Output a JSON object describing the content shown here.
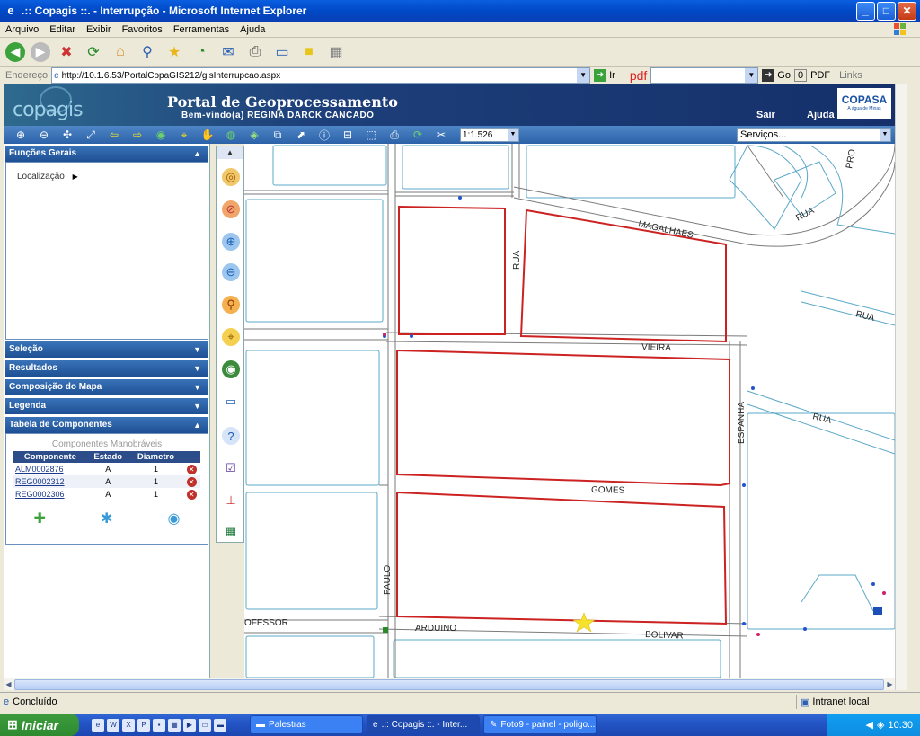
{
  "window": {
    "title": ".:: Copagis ::. - Interrupção - Microsoft Internet Explorer",
    "min": "_",
    "max": "□",
    "close": "✕"
  },
  "menu": [
    "Arquivo",
    "Editar",
    "Exibir",
    "Favoritos",
    "Ferramentas",
    "Ajuda"
  ],
  "address": {
    "label": "Endereço",
    "url": "http://10.1.6.53/PortalCopaGIS212/gisInterrupcao.aspx",
    "go_label": "Ir",
    "pdf_label": "pdf",
    "go2_label": "Go",
    "count": "0",
    "pdf2_label": "PDF",
    "links_label": "Links"
  },
  "portal": {
    "logo": "copagis",
    "title": "Portal de Geoprocessamento",
    "welcome": "Bem-vindo(a) REGINA DARCK CANCADO",
    "exit": "Sair",
    "help": "Ajuda",
    "brand": "COPASA",
    "brand_tagline": "A água de Minas"
  },
  "map_toolbar": {
    "scale": "1:1.526",
    "services": "Serviços..."
  },
  "left_panel": {
    "funcoes_gerais": "Funções Gerais",
    "localizacao": "Localização",
    "sections": [
      "Seleção",
      "Resultados",
      "Composição do Mapa",
      "Legenda"
    ],
    "tabela": "Tabela de Componentes",
    "table_title": "Componentes Manobráveis",
    "columns": [
      "Componente",
      "Estado",
      "Diametro"
    ],
    "rows": [
      {
        "componente": "ALM0002876",
        "estado": "A",
        "diametro": "1"
      },
      {
        "componente": "REG0002312",
        "estado": "A",
        "diametro": "1"
      },
      {
        "componente": "REG0002306",
        "estado": "A",
        "diametro": "1"
      }
    ]
  },
  "map": {
    "streets": {
      "magalhaes": "MAGALHAES",
      "rua1": "RUA",
      "rua2": "RUA",
      "rua3": "RUA",
      "rua4": "RUA",
      "vieira": "VIEIRA",
      "gomes": "GOMES",
      "espanha": "ESPANHA",
      "paulo": "PAULO",
      "ofessor": "OFESSOR",
      "arduino": "ARDUINO",
      "bolivar": "BOLIVAR",
      "pro": "PRO"
    }
  },
  "status": {
    "text": "Concluído",
    "zone": "Intranet local"
  },
  "taskbar": {
    "start": "Iniciar",
    "tasks": [
      "Palestras",
      ".:: Copagis ::. - Inter...",
      "Foto9 - painel - poligo..."
    ],
    "clock": "10:30"
  }
}
